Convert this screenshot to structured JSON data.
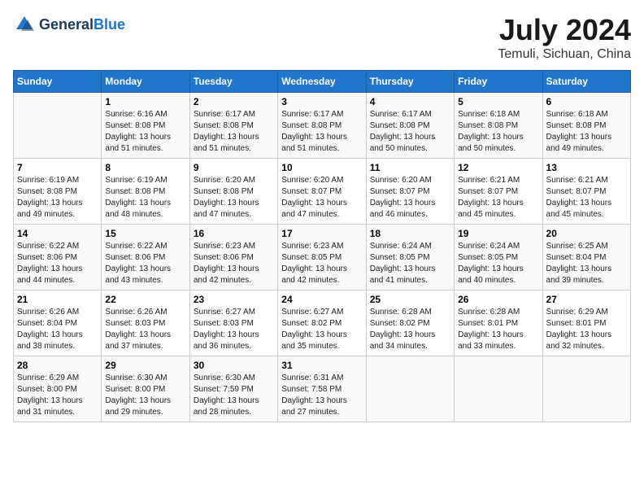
{
  "header": {
    "logo_general": "General",
    "logo_blue": "Blue",
    "title": "July 2024",
    "subtitle": "Temuli, Sichuan, China"
  },
  "calendar": {
    "days_of_week": [
      "Sunday",
      "Monday",
      "Tuesday",
      "Wednesday",
      "Thursday",
      "Friday",
      "Saturday"
    ],
    "weeks": [
      [
        {
          "day": "",
          "info": ""
        },
        {
          "day": "1",
          "info": "Sunrise: 6:16 AM\nSunset: 8:08 PM\nDaylight: 13 hours\nand 51 minutes."
        },
        {
          "day": "2",
          "info": "Sunrise: 6:17 AM\nSunset: 8:08 PM\nDaylight: 13 hours\nand 51 minutes."
        },
        {
          "day": "3",
          "info": "Sunrise: 6:17 AM\nSunset: 8:08 PM\nDaylight: 13 hours\nand 51 minutes."
        },
        {
          "day": "4",
          "info": "Sunrise: 6:17 AM\nSunset: 8:08 PM\nDaylight: 13 hours\nand 50 minutes."
        },
        {
          "day": "5",
          "info": "Sunrise: 6:18 AM\nSunset: 8:08 PM\nDaylight: 13 hours\nand 50 minutes."
        },
        {
          "day": "6",
          "info": "Sunrise: 6:18 AM\nSunset: 8:08 PM\nDaylight: 13 hours\nand 49 minutes."
        }
      ],
      [
        {
          "day": "7",
          "info": "Sunrise: 6:19 AM\nSunset: 8:08 PM\nDaylight: 13 hours\nand 49 minutes."
        },
        {
          "day": "8",
          "info": "Sunrise: 6:19 AM\nSunset: 8:08 PM\nDaylight: 13 hours\nand 48 minutes."
        },
        {
          "day": "9",
          "info": "Sunrise: 6:20 AM\nSunset: 8:08 PM\nDaylight: 13 hours\nand 47 minutes."
        },
        {
          "day": "10",
          "info": "Sunrise: 6:20 AM\nSunset: 8:07 PM\nDaylight: 13 hours\nand 47 minutes."
        },
        {
          "day": "11",
          "info": "Sunrise: 6:20 AM\nSunset: 8:07 PM\nDaylight: 13 hours\nand 46 minutes."
        },
        {
          "day": "12",
          "info": "Sunrise: 6:21 AM\nSunset: 8:07 PM\nDaylight: 13 hours\nand 45 minutes."
        },
        {
          "day": "13",
          "info": "Sunrise: 6:21 AM\nSunset: 8:07 PM\nDaylight: 13 hours\nand 45 minutes."
        }
      ],
      [
        {
          "day": "14",
          "info": "Sunrise: 6:22 AM\nSunset: 8:06 PM\nDaylight: 13 hours\nand 44 minutes."
        },
        {
          "day": "15",
          "info": "Sunrise: 6:22 AM\nSunset: 8:06 PM\nDaylight: 13 hours\nand 43 minutes."
        },
        {
          "day": "16",
          "info": "Sunrise: 6:23 AM\nSunset: 8:06 PM\nDaylight: 13 hours\nand 42 minutes."
        },
        {
          "day": "17",
          "info": "Sunrise: 6:23 AM\nSunset: 8:05 PM\nDaylight: 13 hours\nand 42 minutes."
        },
        {
          "day": "18",
          "info": "Sunrise: 6:24 AM\nSunset: 8:05 PM\nDaylight: 13 hours\nand 41 minutes."
        },
        {
          "day": "19",
          "info": "Sunrise: 6:24 AM\nSunset: 8:05 PM\nDaylight: 13 hours\nand 40 minutes."
        },
        {
          "day": "20",
          "info": "Sunrise: 6:25 AM\nSunset: 8:04 PM\nDaylight: 13 hours\nand 39 minutes."
        }
      ],
      [
        {
          "day": "21",
          "info": "Sunrise: 6:26 AM\nSunset: 8:04 PM\nDaylight: 13 hours\nand 38 minutes."
        },
        {
          "day": "22",
          "info": "Sunrise: 6:26 AM\nSunset: 8:03 PM\nDaylight: 13 hours\nand 37 minutes."
        },
        {
          "day": "23",
          "info": "Sunrise: 6:27 AM\nSunset: 8:03 PM\nDaylight: 13 hours\nand 36 minutes."
        },
        {
          "day": "24",
          "info": "Sunrise: 6:27 AM\nSunset: 8:02 PM\nDaylight: 13 hours\nand 35 minutes."
        },
        {
          "day": "25",
          "info": "Sunrise: 6:28 AM\nSunset: 8:02 PM\nDaylight: 13 hours\nand 34 minutes."
        },
        {
          "day": "26",
          "info": "Sunrise: 6:28 AM\nSunset: 8:01 PM\nDaylight: 13 hours\nand 33 minutes."
        },
        {
          "day": "27",
          "info": "Sunrise: 6:29 AM\nSunset: 8:01 PM\nDaylight: 13 hours\nand 32 minutes."
        }
      ],
      [
        {
          "day": "28",
          "info": "Sunrise: 6:29 AM\nSunset: 8:00 PM\nDaylight: 13 hours\nand 31 minutes."
        },
        {
          "day": "29",
          "info": "Sunrise: 6:30 AM\nSunset: 8:00 PM\nDaylight: 13 hours\nand 29 minutes."
        },
        {
          "day": "30",
          "info": "Sunrise: 6:30 AM\nSunset: 7:59 PM\nDaylight: 13 hours\nand 28 minutes."
        },
        {
          "day": "31",
          "info": "Sunrise: 6:31 AM\nSunset: 7:58 PM\nDaylight: 13 hours\nand 27 minutes."
        },
        {
          "day": "",
          "info": ""
        },
        {
          "day": "",
          "info": ""
        },
        {
          "day": "",
          "info": ""
        }
      ]
    ]
  }
}
